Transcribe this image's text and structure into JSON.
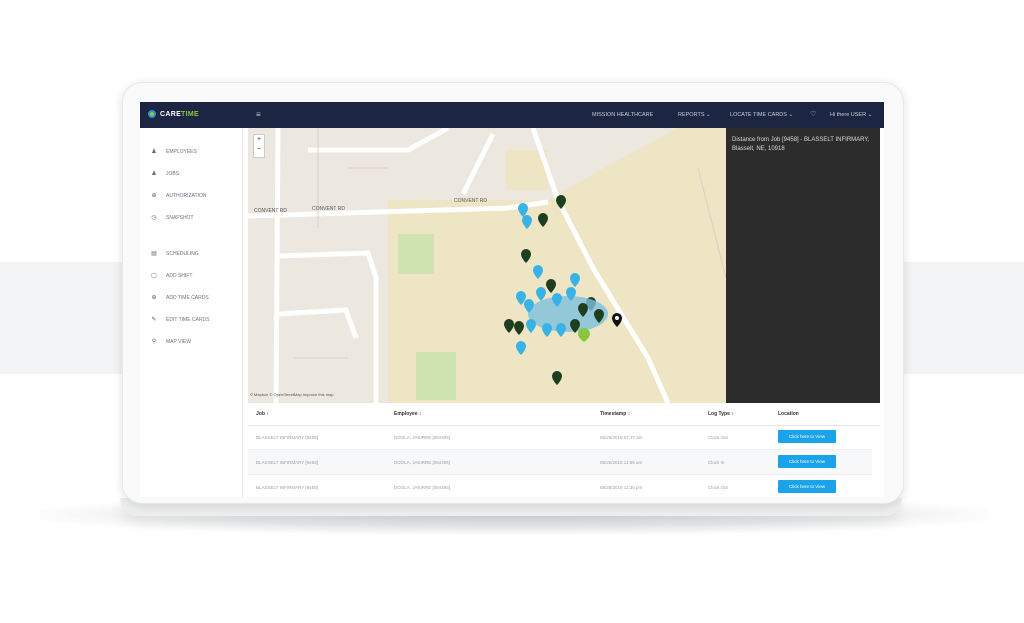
{
  "app": {
    "logo_part1": "CARE",
    "logo_part2": "TIME",
    "menu_icon": "hamburger-icon"
  },
  "topnav": {
    "items": [
      {
        "label": "MISSION HEALTHCARE"
      },
      {
        "label": "REPORTS ⌄"
      },
      {
        "label": "LOCATE TIME CARDS ⌄"
      },
      {
        "label": "♡"
      },
      {
        "label": "Hi there USER ⌄"
      }
    ]
  },
  "sidebar": {
    "items": [
      {
        "label": "EMPLOYEES",
        "icon": "user-icon",
        "glyph": "♟"
      },
      {
        "label": "JOBS",
        "icon": "person-icon",
        "glyph": "♟"
      },
      {
        "label": "AUTHORIZATION",
        "icon": "shield-icon",
        "glyph": "⊕"
      },
      {
        "label": "SNAPSHOT",
        "icon": "clock-icon",
        "glyph": "◷"
      },
      {
        "label": "SCHEDULING",
        "icon": "calendar-icon",
        "glyph": "▤"
      },
      {
        "label": "ADD SHIFT",
        "icon": "calendar-add-icon",
        "glyph": "▢"
      },
      {
        "label": "ADD TIME CARDS",
        "icon": "plus-circle-icon",
        "glyph": "⊕"
      },
      {
        "label": "EDIT TIME CARDS",
        "icon": "pencil-icon",
        "glyph": "✎"
      },
      {
        "label": "MAP VIEW",
        "icon": "map-pin-icon",
        "glyph": "⚲"
      }
    ]
  },
  "map": {
    "roads": {
      "convent_rd_left": "CONVENT RD",
      "convent_rd_mid": "CONVENT RD",
      "convent_rd_right": "CONVENT RD"
    },
    "zoom_in": "+",
    "zoom_out": "−",
    "attribution": "© Mapbox © OpenStreetMap Improve this map"
  },
  "info_panel": {
    "title": "Distance from Job [9458] - BLASSELT INFIRMARY, Blasselt, NE, 10918"
  },
  "table": {
    "headers": [
      "Job ↕",
      "Employee ↕",
      "Timestamp ↕",
      "Log Type ↕",
      "Location"
    ],
    "rows": [
      {
        "job": "BLASSELT INFIRMARY [9458]",
        "employee": "DOOLA, JAKIRRE [084495]",
        "timestamp": "05/28/2018 07:37 am",
        "log_type": "Clock Out",
        "location_btn": "Click here to View"
      },
      {
        "job": "BLASSELT INFIRMARY [9458]",
        "employee": "DOOLA, JAKIRRE [084495]",
        "timestamp": "05/25/2018 11:58 am",
        "log_type": "Clock In",
        "location_btn": "Click here to View"
      },
      {
        "job": "BLASSELT INFIRMARY [9458]",
        "employee": "DOOLA, JAKIRRE [084495]",
        "timestamp": "05/28/2018 11:35 pm",
        "log_type": "Clock Out",
        "location_btn": "Click here to View"
      }
    ]
  },
  "colors": {
    "topbar": "#1c2541",
    "map_land": "#ece7df",
    "map_park": "#ede5c4",
    "marker_blue": "#39b3e6",
    "marker_green": "#1f3d1f",
    "button_blue": "#1aa3e8",
    "info_panel": "#2c2c2c"
  }
}
